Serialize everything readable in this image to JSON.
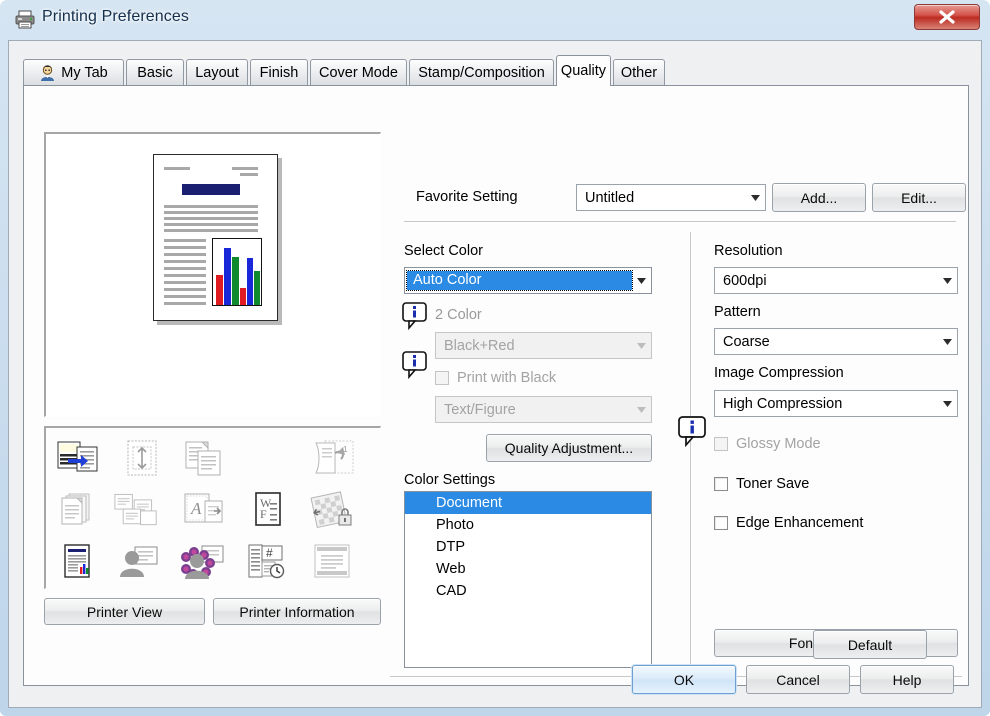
{
  "window": {
    "title": "Printing Preferences",
    "title_icon": "printer-icon",
    "close_label": "X"
  },
  "tabs": [
    {
      "label": "My Tab",
      "icon": "user-avatar-icon",
      "active": false
    },
    {
      "label": "Basic",
      "icon": "",
      "active": false
    },
    {
      "label": "Layout",
      "icon": "",
      "active": false
    },
    {
      "label": "Finish",
      "icon": "",
      "active": false
    },
    {
      "label": "Cover Mode",
      "icon": "",
      "active": false
    },
    {
      "label": "Stamp/Composition",
      "icon": "",
      "active": false
    },
    {
      "label": "Quality",
      "icon": "",
      "active": true
    },
    {
      "label": "Other",
      "icon": "",
      "active": false
    }
  ],
  "preview": {
    "printer_view_label": "Printer View",
    "printer_information_label": "Printer Information",
    "page_title_color": "#1a1f71",
    "chart_bar_colors": [
      "#e11b22",
      "#1a27d8",
      "#0f8a2e",
      "#e11b22",
      "#1a27d8",
      "#0f8a2e"
    ],
    "icons": [
      "two-sided-print-icon",
      "page-margin-icon",
      "collate-copies-icon",
      "",
      "booklet-rotate-icon",
      "multiple-copies-icon",
      "n-up-layout-icon",
      "watermark-overlay-icon",
      "watermark-text-icon",
      "secure-print-icon",
      "color-document-icon",
      "user-box-icon",
      "user-authentication-icon",
      "job-schedule-icon",
      "banner-page-icon"
    ]
  },
  "favorite": {
    "label": "Favorite Setting",
    "value": "Untitled",
    "add_label": "Add...",
    "edit_label": "Edit..."
  },
  "select_color": {
    "group_label": "Select Color",
    "value": "Auto Color",
    "two_color_label": "2 Color",
    "two_color_value": "Black+Red",
    "print_with_black_label": "Print with Black",
    "print_with_black_value": "Text/Figure",
    "quality_adjustment_label": "Quality Adjustment..."
  },
  "color_settings": {
    "group_label": "Color Settings",
    "items": [
      "Document",
      "Photo",
      "DTP",
      "Web",
      "CAD"
    ],
    "selected_index": 0
  },
  "resolution": {
    "group_label": "Resolution",
    "value": "600dpi"
  },
  "pattern": {
    "group_label": "Pattern",
    "value": "Coarse"
  },
  "image_compression": {
    "group_label": "Image Compression",
    "value": "High Compression"
  },
  "checkboxes": {
    "glossy_mode": {
      "label": "Glossy Mode",
      "checked": false,
      "disabled": true
    },
    "toner_save": {
      "label": "Toner Save",
      "checked": false,
      "disabled": false
    },
    "edge_enhancement": {
      "label": "Edge Enhancement",
      "checked": false,
      "disabled": false
    }
  },
  "font_settings_label": "Font Settings...",
  "default_label": "Default",
  "footer": {
    "ok_label": "OK",
    "cancel_label": "Cancel",
    "help_label": "Help"
  },
  "colors": {
    "accent_selection": "#2a8ae4",
    "title_navy": "#1a1f71",
    "close_red": "#bb2b21"
  }
}
